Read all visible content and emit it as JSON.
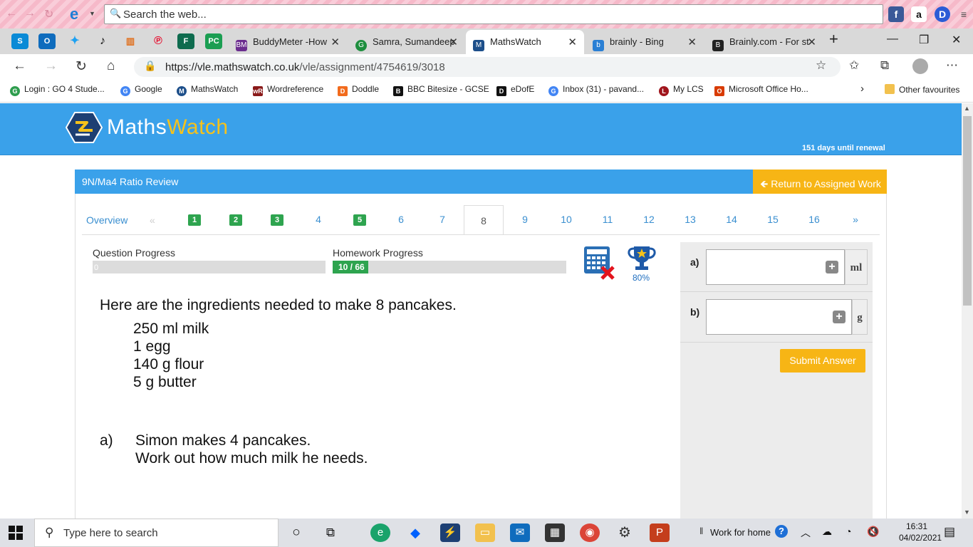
{
  "browser": {
    "search_placeholder": "Search the web...",
    "tabs": [
      {
        "label": "BuddyMeter -How",
        "icon": "buddymeter-icon",
        "color": "#6b2d8f"
      },
      {
        "label": "Samra, Sumandeep",
        "icon": "google-classroom-icon",
        "color": "#1e8e3e"
      },
      {
        "label": "MathsWatch",
        "icon": "mathswatch-icon",
        "color": "#1d4f8a"
      },
      {
        "label": "brainly - Bing",
        "icon": "bing-icon",
        "color": "#2a7fd4"
      },
      {
        "label": "Brainly.com - For st",
        "icon": "brainly-icon",
        "color": "#222222"
      }
    ],
    "url_host": "https://vle.mathswatch.co.uk",
    "url_path": "/vle/assignment/4754619/3018",
    "favourites": [
      {
        "label": "Login : GO 4 Stude...",
        "color": "#2e9d4e"
      },
      {
        "label": "Google",
        "color": "#4285f4"
      },
      {
        "label": "MathsWatch",
        "color": "#1d4f8a"
      },
      {
        "label": "Wordreference",
        "color": "#8a1a1a"
      },
      {
        "label": "Doddle",
        "color": "#f26b1d"
      },
      {
        "label": "BBC Bitesize - GCSE",
        "color": "#111111"
      },
      {
        "label": "eDofE",
        "color": "#111111"
      },
      {
        "label": "Inbox (31) - pavand...",
        "color": "#4285f4"
      },
      {
        "label": "My LCS",
        "color": "#a0151d"
      },
      {
        "label": "Microsoft Office Ho...",
        "color": "#d83b01"
      }
    ],
    "other_favourites": "Other favourites"
  },
  "site": {
    "logo_part1": "Maths",
    "logo_part2": "Watch",
    "renewal": "151 days until renewal"
  },
  "assignment": {
    "title": "9N/Ma4 Ratio Review",
    "return_label": "Return to Assigned Work",
    "overview_label": "Overview",
    "prev_label": "«",
    "next_label": "»",
    "questions": [
      {
        "label": "1",
        "done": true
      },
      {
        "label": "2",
        "done": true
      },
      {
        "label": "3",
        "done": true
      },
      {
        "label": "4",
        "done": false
      },
      {
        "label": "5",
        "done": true
      },
      {
        "label": "6",
        "done": false
      },
      {
        "label": "7",
        "done": false
      },
      {
        "label": "8",
        "done": false,
        "active": true
      },
      {
        "label": "9",
        "done": false
      },
      {
        "label": "10",
        "done": false
      },
      {
        "label": "11",
        "done": false
      },
      {
        "label": "12",
        "done": false
      },
      {
        "label": "13",
        "done": false
      },
      {
        "label": "14",
        "done": false
      },
      {
        "label": "15",
        "done": false
      },
      {
        "label": "16",
        "done": false
      }
    ],
    "question_progress_label": "Question Progress",
    "question_progress_value": "0",
    "homework_progress_label": "Homework Progress",
    "homework_progress_text": "10 / 66",
    "homework_progress_fraction": 0.1515,
    "trophy_percent": "80%"
  },
  "question": {
    "intro": "Here are the ingredients needed to make 8 pancakes.",
    "ingredients": [
      "250 ml milk",
      "1 egg",
      "140 g flour",
      "5 g butter"
    ],
    "part_a_label": "a)",
    "part_a_line1": "Simon makes 4 pancakes.",
    "part_a_line2": "Work out how much milk he needs."
  },
  "answers": {
    "a_label": "a)",
    "a_unit": "ml",
    "b_label": "b)",
    "b_unit": "g",
    "submit_label": "Submit Answer"
  },
  "taskbar": {
    "search_placeholder": "Type here to search",
    "work_label": "Work for home",
    "time": "16:31",
    "date": "04/02/2021"
  }
}
